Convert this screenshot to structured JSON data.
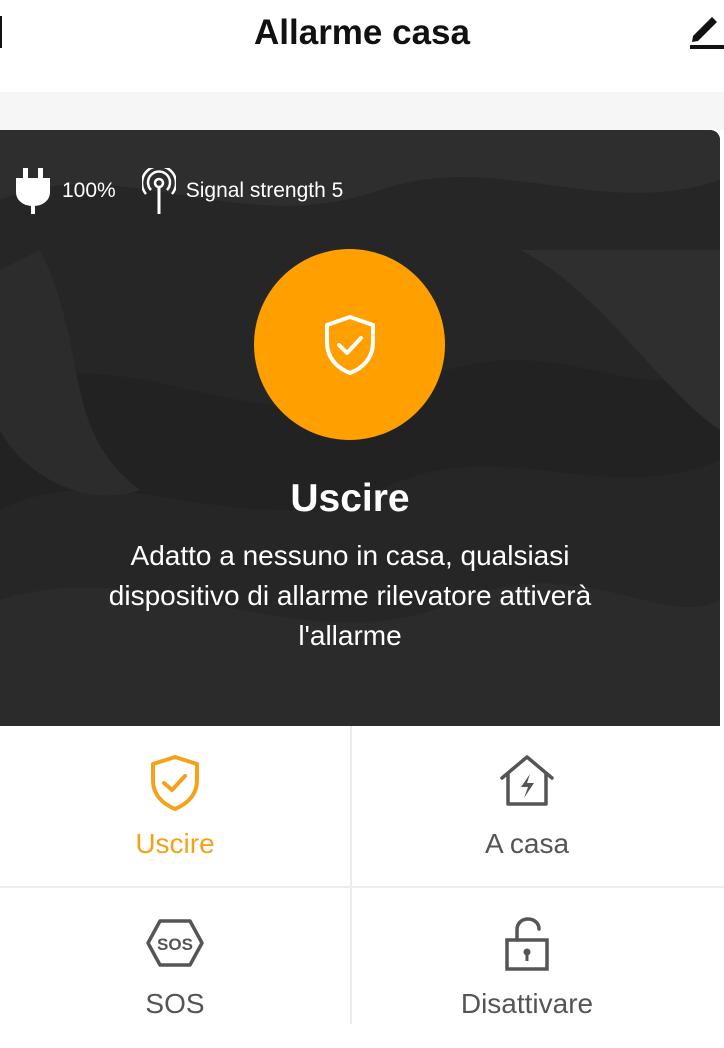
{
  "header": {
    "title": "Allarme casa"
  },
  "status": {
    "battery_text": "100%",
    "signal_text": "Signal strength 5"
  },
  "current_mode": {
    "title": "Uscire",
    "description": "Adatto a nessuno in casa, qualsiasi dispositivo di allarme rilevatore attiverà l'allarme"
  },
  "modes": [
    {
      "label": "Uscire",
      "icon": "shield-check-icon",
      "active": true
    },
    {
      "label": "A casa",
      "icon": "home-bolt-icon",
      "active": false
    },
    {
      "label": "SOS",
      "icon": "sos-icon",
      "active": false
    },
    {
      "label": "Disattivare",
      "icon": "unlock-icon",
      "active": false
    }
  ],
  "colors": {
    "accent": "#ff9f00",
    "active_label": "#f5a21b",
    "hero_bg": "#262626",
    "inactive": "#555555"
  }
}
